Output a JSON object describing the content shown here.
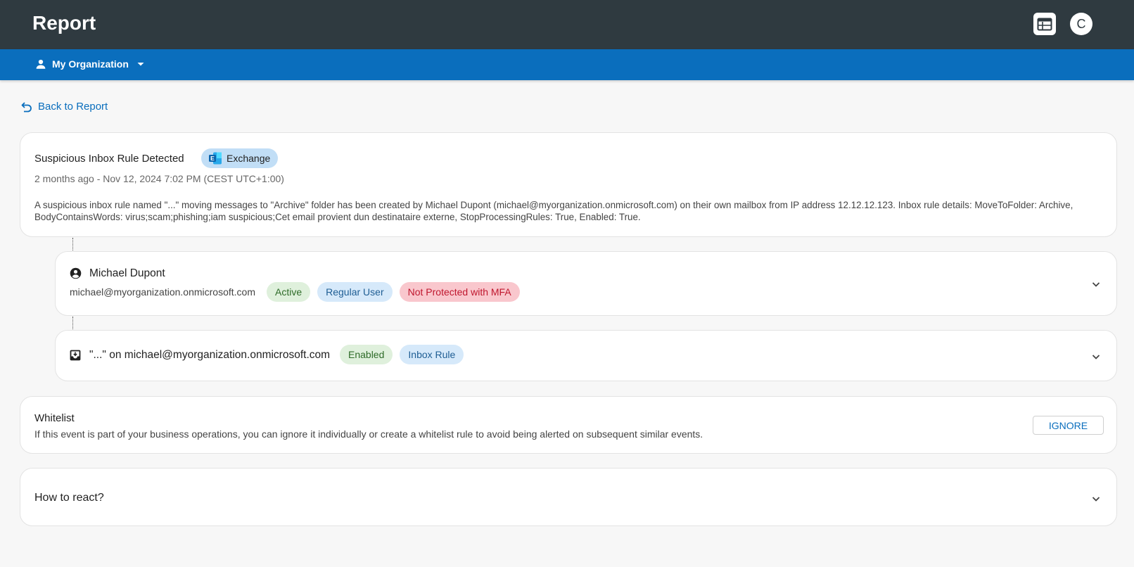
{
  "header": {
    "title": "Report",
    "avatar_initial": "C"
  },
  "org_bar": {
    "org_name": "My Organization"
  },
  "back_link": {
    "label": "Back to Report"
  },
  "alert": {
    "title": "Suspicious Inbox Rule Detected",
    "source_badge": "Exchange",
    "time": "2 months ago - Nov 12, 2024 7:02 PM (CEST UTC+1:00)",
    "description": "A suspicious inbox rule named \"...\" moving messages to \"Archive\" folder has been created by Michael Dupont (michael@myorganization.onmicrosoft.com) on their own mailbox from IP address 12.12.12.123. Inbox rule details: MoveToFolder: Archive, BodyContainsWords: virus;scam;phishing;iam suspicious;Cet email provient dun destinataire externe, StopProcessingRules: True, Enabled: True."
  },
  "user": {
    "name": "Michael Dupont",
    "email": "michael@myorganization.onmicrosoft.com",
    "badges": [
      "Active",
      "Regular User",
      "Not Protected with MFA"
    ]
  },
  "rule": {
    "title": "\"...\" on michael@myorganization.onmicrosoft.com",
    "badges": [
      "Enabled",
      "Inbox Rule"
    ]
  },
  "whitelist": {
    "title": "Whitelist",
    "description": "If this event is part of your business operations, you can ignore it individually or create a whitelist rule to avoid being alerted on subsequent similar events.",
    "ignore_label": "IGNORE"
  },
  "react": {
    "title": "How to react?"
  },
  "colors": {
    "topbar": "#2f3a40",
    "org_bar": "#0a6ebd",
    "accent": "#0a6ebd",
    "badge_green": "#dff0dc",
    "badge_blue": "#d6e9fa",
    "badge_red": "#f9c7cd"
  }
}
